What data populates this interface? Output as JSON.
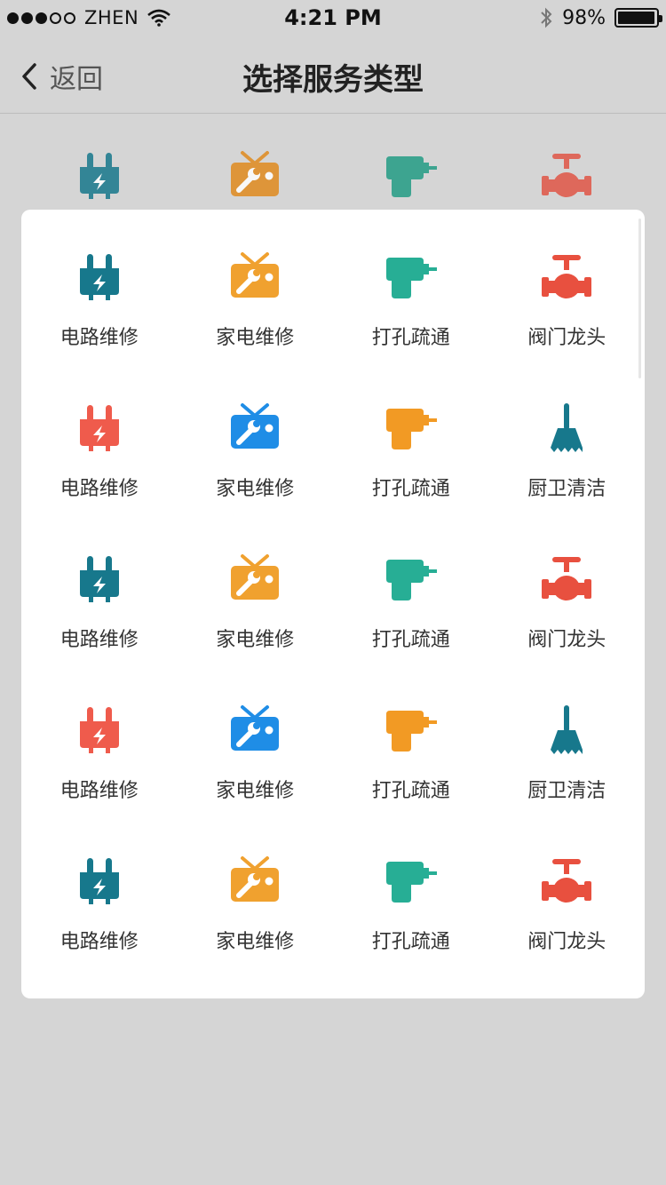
{
  "status_bar": {
    "carrier": "ZHEN",
    "time": "4:21 PM",
    "battery": "98%",
    "battery_level": 0.98
  },
  "nav": {
    "back_label": "返回",
    "title": "选择服务类型"
  },
  "background_icons": [
    {
      "icon": "plug-icon",
      "color": "#17788c"
    },
    {
      "icon": "tv-repair-icon",
      "color": "#e08a1e"
    },
    {
      "icon": "drill-icon",
      "color": "#239c85"
    },
    {
      "icon": "valve-faucet-icon",
      "color": "#e05546"
    }
  ],
  "services": [
    {
      "label": "电路维修",
      "icon": "plug-icon",
      "color": "#17788c"
    },
    {
      "label": "家电维修",
      "icon": "tv-repair-icon",
      "color": "#f0a12f"
    },
    {
      "label": "打孔疏通",
      "icon": "drill-icon",
      "color": "#27ae95"
    },
    {
      "label": "阀门龙头",
      "icon": "valve-faucet-icon",
      "color": "#e8503f"
    },
    {
      "label": "电路维修",
      "icon": "plug-icon",
      "color": "#ef5b4c"
    },
    {
      "label": "家电维修",
      "icon": "tv-repair-icon",
      "color": "#1f8de6"
    },
    {
      "label": "打孔疏通",
      "icon": "drill-icon",
      "color": "#f29a24"
    },
    {
      "label": "厨卫清洁",
      "icon": "broom-icon",
      "color": "#17788c"
    },
    {
      "label": "电路维修",
      "icon": "plug-icon",
      "color": "#17788c"
    },
    {
      "label": "家电维修",
      "icon": "tv-repair-icon",
      "color": "#f0a12f"
    },
    {
      "label": "打孔疏通",
      "icon": "drill-icon",
      "color": "#27ae95"
    },
    {
      "label": "阀门龙头",
      "icon": "valve-faucet-icon",
      "color": "#e8503f"
    },
    {
      "label": "电路维修",
      "icon": "plug-icon",
      "color": "#ef5b4c"
    },
    {
      "label": "家电维修",
      "icon": "tv-repair-icon",
      "color": "#1f8de6"
    },
    {
      "label": "打孔疏通",
      "icon": "drill-icon",
      "color": "#f29a24"
    },
    {
      "label": "厨卫清洁",
      "icon": "broom-icon",
      "color": "#17788c"
    },
    {
      "label": "电路维修",
      "icon": "plug-icon",
      "color": "#17788c"
    },
    {
      "label": "家电维修",
      "icon": "tv-repair-icon",
      "color": "#f0a12f"
    },
    {
      "label": "打孔疏通",
      "icon": "drill-icon",
      "color": "#27ae95"
    },
    {
      "label": "阀门龙头",
      "icon": "valve-faucet-icon",
      "color": "#e8503f"
    }
  ]
}
